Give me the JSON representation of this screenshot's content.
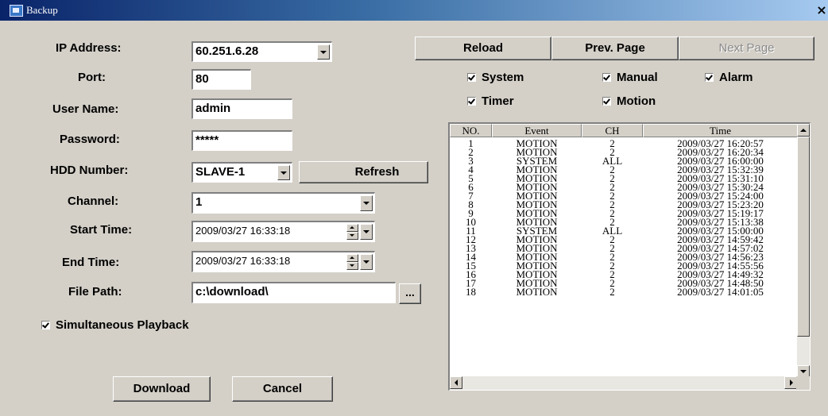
{
  "window": {
    "title": "Backup",
    "close_glyph": "×",
    "icon": "backup-app-icon"
  },
  "form": {
    "ip_label": "IP Address:",
    "ip_value": "60.251.6.28",
    "port_label": "Port:",
    "port_value": "80",
    "user_label": "User Name:",
    "user_value": "admin",
    "password_label": "Password:",
    "password_value": "*****",
    "hdd_label": "HDD Number:",
    "hdd_value": "SLAVE-1",
    "refresh_label": "Refresh",
    "channel_label": "Channel:",
    "channel_value": "1",
    "start_label": "Start Time:",
    "start_value": "2009/03/27 16:33:18",
    "end_label": "End Time:",
    "end_value": "2009/03/27 16:33:18",
    "path_label": "File Path:",
    "path_value": "c:\\download\\",
    "browse_label": "...",
    "simultaneous_label": "Simultaneous Playback",
    "download_label": "Download",
    "cancel_label": "Cancel"
  },
  "nav": {
    "reload": "Reload",
    "prev": "Prev. Page",
    "next": "Next Page"
  },
  "filters": {
    "system": {
      "label": "System",
      "checked": true
    },
    "manual": {
      "label": "Manual",
      "checked": true
    },
    "alarm": {
      "label": "Alarm",
      "checked": true
    },
    "timer": {
      "label": "Timer",
      "checked": true
    },
    "motion": {
      "label": "Motion",
      "checked": true
    }
  },
  "table": {
    "columns": [
      "NO.",
      "Event",
      "CH",
      "Time"
    ],
    "rows": [
      [
        "1",
        "MOTION",
        "2",
        "2009/03/27 16:20:57"
      ],
      [
        "2",
        "MOTION",
        "2",
        "2009/03/27 16:20:34"
      ],
      [
        "3",
        "SYSTEM",
        "ALL",
        "2009/03/27 16:00:00"
      ],
      [
        "4",
        "MOTION",
        "2",
        "2009/03/27 15:32:39"
      ],
      [
        "5",
        "MOTION",
        "2",
        "2009/03/27 15:31:10"
      ],
      [
        "6",
        "MOTION",
        "2",
        "2009/03/27 15:30:24"
      ],
      [
        "7",
        "MOTION",
        "2",
        "2009/03/27 15:24:00"
      ],
      [
        "8",
        "MOTION",
        "2",
        "2009/03/27 15:23:20"
      ],
      [
        "9",
        "MOTION",
        "2",
        "2009/03/27 15:19:17"
      ],
      [
        "10",
        "MOTION",
        "2",
        "2009/03/27 15:13:38"
      ],
      [
        "11",
        "SYSTEM",
        "ALL",
        "2009/03/27 15:00:00"
      ],
      [
        "12",
        "MOTION",
        "2",
        "2009/03/27 14:59:42"
      ],
      [
        "13",
        "MOTION",
        "2",
        "2009/03/27 14:57:02"
      ],
      [
        "14",
        "MOTION",
        "2",
        "2009/03/27 14:56:23"
      ],
      [
        "15",
        "MOTION",
        "2",
        "2009/03/27 14:55:56"
      ],
      [
        "16",
        "MOTION",
        "2",
        "2009/03/27 14:49:32"
      ],
      [
        "17",
        "MOTION",
        "2",
        "2009/03/27 14:48:50"
      ],
      [
        "18",
        "MOTION",
        "2",
        "2009/03/27 14:01:05"
      ]
    ]
  }
}
